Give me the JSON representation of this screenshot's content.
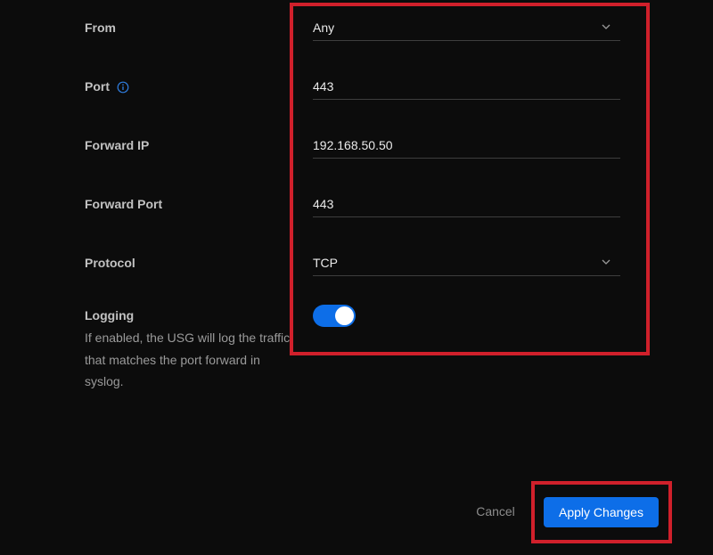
{
  "form": {
    "from": {
      "label": "From",
      "value": "Any"
    },
    "port": {
      "label": "Port",
      "value": "443"
    },
    "forward_ip": {
      "label": "Forward IP",
      "value": "192.168.50.50"
    },
    "forward_port": {
      "label": "Forward Port",
      "value": "443"
    },
    "protocol": {
      "label": "Protocol",
      "value": "TCP"
    },
    "logging": {
      "label": "Logging",
      "description": "If enabled, the USG will log the traffic that matches the port forward in syslog.",
      "enabled": true
    }
  },
  "actions": {
    "cancel_label": "Cancel",
    "apply_label": "Apply Changes"
  },
  "icons": {
    "port_info": "info-icon",
    "dropdown": "chevron-down-icon"
  },
  "colors": {
    "accent": "#0d6ee8",
    "highlight": "#d0202b",
    "background": "#0c0c0c"
  }
}
